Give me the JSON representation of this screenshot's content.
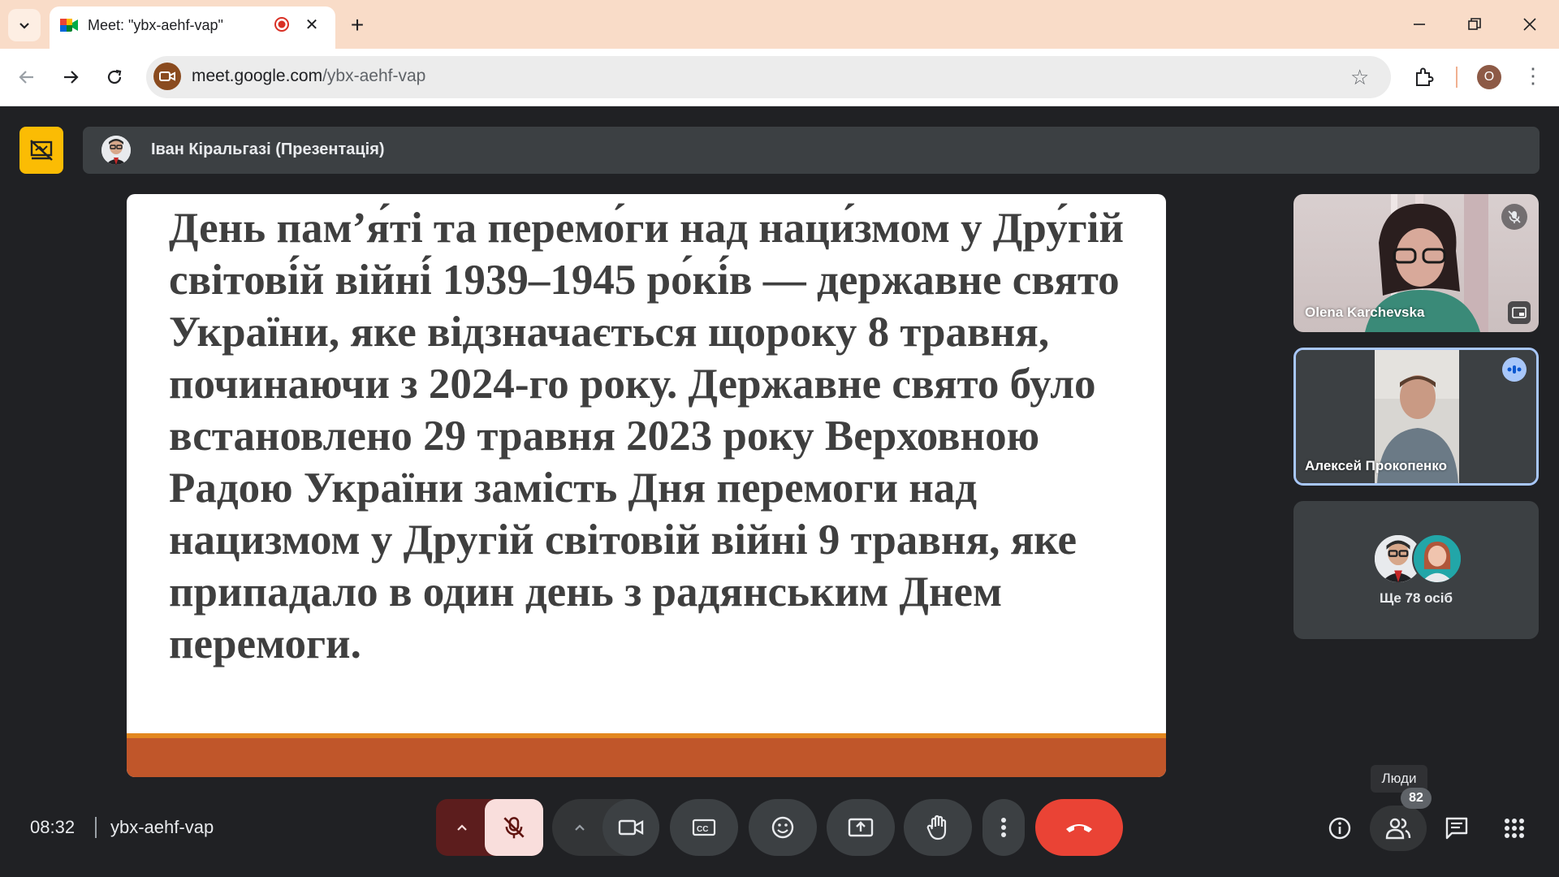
{
  "browser": {
    "tab_title": "Meet: \"ybx-aehf-vap\"",
    "url_host": "meet.google.com",
    "url_path": "/ybx-aehf-vap",
    "profile_initial": "O",
    "new_tab_label": "+",
    "close_tab_label": "✕"
  },
  "meet": {
    "presenter_bar": {
      "name": "Іван Кіральгазі (Презентація)"
    },
    "slide": {
      "text": "День пам’я́ті та перемо́ги над наци́змом у Дру́гій світові́й війні́ 1939–1945 ро́кі́в — державне свято України, яке відзначається щороку 8 травня, починаючи з 2024-го року. Державне свято було встановлено 29 травня 2023 року Верховною Радою України замість Дня перемоги над нацизмом у Другій світовій війні 9 травня, яке припадало в один день з радянським Днем перемоги."
    },
    "participants": [
      {
        "name": "Olena Karchevska",
        "muted": true
      },
      {
        "name": "Алексей Прокопенко",
        "speaking": true
      }
    ],
    "more_participants_label": "Ще 78 осіб",
    "people_tooltip": "Люди",
    "people_count": "82",
    "time": "08:32",
    "meeting_code": "ybx-aehf-vap",
    "colors": {
      "accent_yellow": "#fbbc04",
      "end_call_red": "#ea4335",
      "speaking_border": "#a8c7fa",
      "slide_stripe": "#c0562a"
    }
  }
}
